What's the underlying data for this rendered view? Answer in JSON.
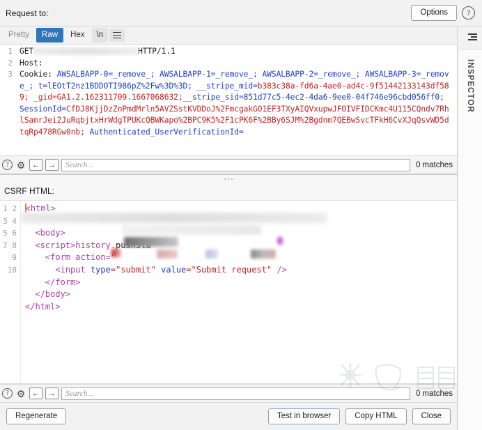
{
  "header": {
    "request_to_label": "Request to:",
    "request_to_value": "",
    "options_label": "Options",
    "help_icon": "question-circle-icon"
  },
  "request_viewer": {
    "tabs": [
      {
        "label": "Pretty",
        "active": false
      },
      {
        "label": "Raw",
        "active": true
      },
      {
        "label": "Hex",
        "active": false
      }
    ],
    "newline_toggle": "\\n",
    "menu_icon": "hamburger-icon",
    "line_numbers": [
      "1",
      "2",
      "3"
    ],
    "lines": {
      "l1_method": "GET",
      "l1_proto": "HTTP/1.1",
      "l2_header": "Host:",
      "l3_header": "Cookie:",
      "cookie_part1": "AWSALBAPP-0=_remove_; AWSALBAPP-1=_remove_; AWSALBAPP-2=_remove_; AWSALBAPP-3=_remove_; t=lEOtT2nz1BDDOTI986pZ%2Fw%3D%3D; __stripe_mid=",
      "cookie_part2": "b383c38a-fd6a-4ae0-ad4c-9f51442133143df589; _gid=GA1.2.162311709.1667068632;",
      "cookie_part3": "__stripe_sid=851d77c5-4ec2-4da6-9ee0-04f746e96cbd056ff0; SessionId=",
      "cookie_part4": "CfDJ8KjjDzZnPmdMrln5AVZSstKVDDoJ%2FmcgakGO1EF3TXyAIQVxupwJFOIVFIDCKmc4U115CQndv7RhlSamrJei2JuRqbjtxHrWdgTPUKcQBWKapo%2BPC9K5%2F1cPK6F%2BBy6SJM%2Bgdnm7QEBwSvcTFkH6CvXJqQsvWD5dtqRp478RGw0nb;",
      "cookie_part5": "Authenticated_UserVerificationId="
    }
  },
  "request_search": {
    "help_icon": "question-circle-icon",
    "gear_icon": "gear-icon",
    "prev_icon": "arrow-left-icon",
    "next_icon": "arrow-right-icon",
    "placeholder": "Search...",
    "value": "",
    "matches": "0 matches"
  },
  "csrf": {
    "title": "CSRF HTML:",
    "line_numbers": [
      "1",
      "2",
      "3",
      "4",
      "5",
      "6",
      "7",
      "8",
      "9",
      "10"
    ],
    "code": {
      "l1": "<html>",
      "l2": "",
      "l3": "<body>",
      "l4_prefix": "<script>history.",
      "l4_redacted": "pushSta",
      "l5": "<form action=\"",
      "l6_tag": "input",
      "l6_attr1": "type",
      "l6_val1": "submit",
      "l6_attr2": "value",
      "l6_val2": "Submit request",
      "l7": "</form>",
      "l8": "</body>",
      "l9": "</html>",
      "l10": ""
    }
  },
  "csrf_search": {
    "help_icon": "question-circle-icon",
    "gear_icon": "gear-icon",
    "prev_icon": "arrow-left-icon",
    "next_icon": "arrow-right-icon",
    "placeholder": "Search...",
    "value": "",
    "matches": "0 matches"
  },
  "footer": {
    "regenerate_label": "Regenerate",
    "test_in_browser_label": "Test in browser",
    "copy_html_label": "Copy HTML",
    "close_label": "Close"
  },
  "inspector": {
    "icon": "layers-icon",
    "label": "INSPECTOR"
  },
  "colors": {
    "accent_blue": "#3274b8",
    "syntax_blue": "#1f3fd0",
    "syntax_red": "#cc2222",
    "syntax_tag": "#b13fb1",
    "caret_orange": "#e8821a",
    "window_bg": "#f2f2f2"
  }
}
